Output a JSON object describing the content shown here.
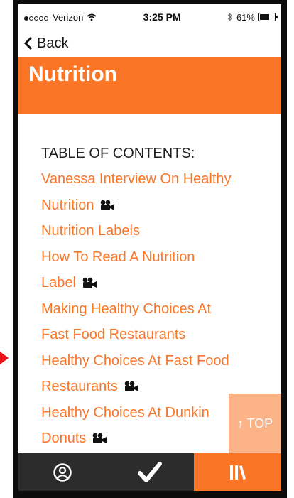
{
  "status_bar": {
    "carrier": "Verizon",
    "time": "3:25 PM",
    "battery": "61%",
    "battery_level": 0.61
  },
  "nav": {
    "back_label": "Back"
  },
  "header": {
    "title": "Nutrition"
  },
  "toc": {
    "title": "TABLE OF CONTENTS:",
    "items": [
      {
        "line1": "Vanessa Interview On Healthy",
        "line2": "Nutrition",
        "icon": "video-camera-icon"
      },
      {
        "line1": "Nutrition Labels"
      },
      {
        "line1": "How To Read A Nutrition",
        "line2": "Label",
        "icon": "video-camera-icon"
      },
      {
        "line1": "Making Healthy Choices At",
        "line2": "Fast Food Restaurants"
      },
      {
        "line1": "Healthy Choices At Fast Food",
        "line2": "Restaurants",
        "icon": "video-camera-icon"
      },
      {
        "line1": "Healthy Choices At Dunkin",
        "line2": "Donuts",
        "icon": "video-camera-icon"
      }
    ]
  },
  "top_button": {
    "label": "↑ TOP"
  },
  "tab_bar": {
    "tabs": [
      {
        "icon": "profile-icon"
      },
      {
        "icon": "checkmark-icon"
      },
      {
        "icon": "library-icon",
        "active": true
      }
    ]
  }
}
